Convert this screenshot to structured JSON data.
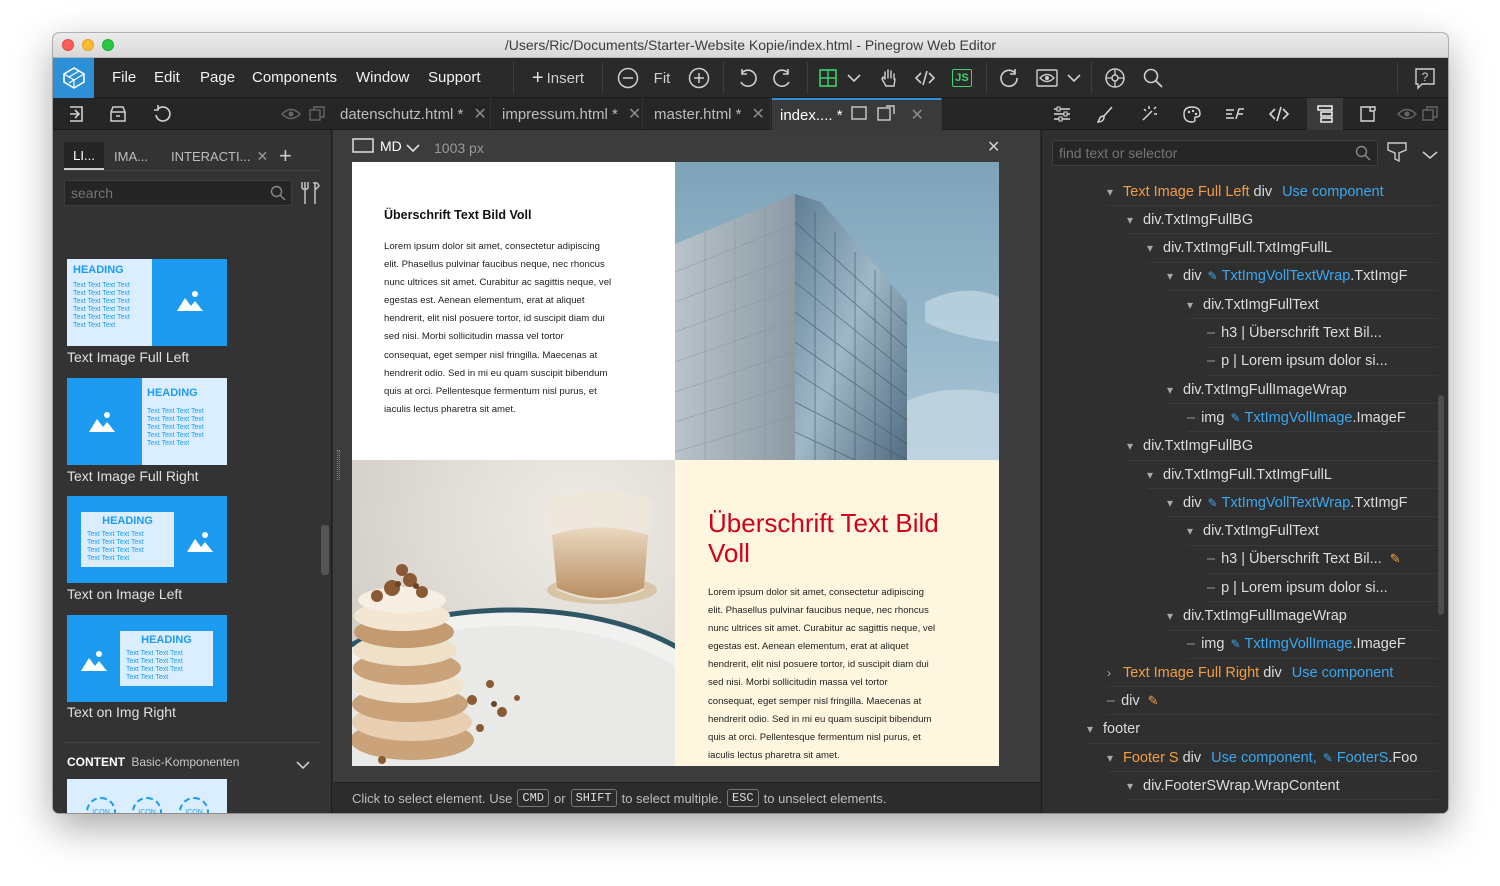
{
  "window": {
    "title": "/Users/Ric/Documents/Starter-Website Kopie/index.html - Pinegrow Web Editor"
  },
  "menu": {
    "items": [
      "File",
      "Edit",
      "Page",
      "Components",
      "Window",
      "Support"
    ],
    "insert_label": "Insert",
    "fit_label": "Fit",
    "js_label": "JS"
  },
  "tabs": [
    {
      "label": "datenschutz.html *",
      "active": false
    },
    {
      "label": "impressum.html *",
      "active": false
    },
    {
      "label": "master.html *",
      "active": false
    },
    {
      "label": "index.... *",
      "active": true
    }
  ],
  "library": {
    "tabs": [
      "LI...",
      "IMA...",
      "INTERACTI..."
    ],
    "search_placeholder": "search",
    "components": [
      {
        "label": "Text Image Full Left",
        "heading": "HEADING",
        "lines": [
          "Text Text Text Text",
          "Text Text Text Text",
          "Text Text Text Text",
          "Text Text Text Text",
          "Text Text Text Text",
          "Text Text Text"
        ]
      },
      {
        "label": "Text Image Full Right",
        "heading": "HEADING",
        "lines": [
          "Text Text Text Text",
          "Text Text Text Text",
          "Text Text Text Text",
          "Text Text Text Text",
          "Text Text Text"
        ]
      },
      {
        "label": "Text on Image Left",
        "heading": "HEADING",
        "lines": [
          "Text Text Text Text",
          "Text Text Text Text",
          "Text Text Text Text",
          "Text Text Text"
        ]
      },
      {
        "label": "Text on Img Right",
        "heading": "HEADING",
        "lines": [
          "Text Text Text Text",
          "Text Text Text Text",
          "Text Text Text Text",
          "Text Text Text"
        ]
      }
    ],
    "section_title": "CONTENT",
    "section_subtitle": "Basic-Komponenten",
    "icon_label": "ICON"
  },
  "canvas": {
    "device": "MD",
    "width_label": "1003 px",
    "block1_heading": "Überschrift Text Bild Voll",
    "block1_lines": [
      "Lorem ipsum dolor sit amet, consectetur adipiscing",
      "elit. Phasellus pulvinar faucibus neque, nec rhoncus",
      "nunc ultrices sit amet. Curabitur ac sagittis neque, vel",
      "egestas est. Aenean elementum, erat at aliquet",
      "hendrerit, elit nisl posuere tortor, id suscipit diam dui",
      "sed nisi. Morbi sollicitudin massa vel tortor",
      "consequat, eget semper nisl fringilla. Maecenas at",
      "hendrerit odio. Sed in mi eu quam suscipit bibendum",
      "quis at orci. Pellentesque fermentum nisl purus, et",
      "iaculis lectus pharetra sit amet."
    ],
    "block2_heading_line1": "Überschrift Text Bild",
    "block2_heading_line2": "Voll",
    "block2_lines": [
      "Lorem ipsum dolor sit amet, consectetur adipiscing",
      "elit. Phasellus pulvinar faucibus neque, nec rhoncus",
      "nunc ultrices sit amet. Curabitur ac sagittis neque, vel",
      "egestas est. Aenean elementum, erat at aliquet",
      "hendrerit, elit nisl posuere tortor, id suscipit diam dui",
      "sed nisi. Morbi sollicitudin massa vel tortor",
      "consequat, eget semper nisl fringilla. Maecenas at",
      "hendrerit odio. Sed in mi eu quam suscipit bibendum",
      "quis at orci. Pellentesque fermentum nisl purus, et",
      "iaculis lectus pharetra sit amet."
    ],
    "heading_color": "#d0021b",
    "cream_bg": "#fef6de"
  },
  "status": {
    "text1": "Click to select element. Use",
    "key1": "CMD",
    "text2": "or",
    "key2": "SHIFT",
    "text3": "to select multiple.",
    "key3": "ESC",
    "text4": "to unselect elements."
  },
  "tree": {
    "find_placeholder": "find text or selector",
    "rows": [
      {
        "arrow": "▾",
        "name": "Text Image Full Left",
        "tag": "div",
        "extra": "Use component"
      },
      {
        "arrow": "▾",
        "text": "div.TxtImgFullBG"
      },
      {
        "arrow": "▾",
        "text": "div.TxtImgFull.TxtImgFullL"
      },
      {
        "arrow": "▾",
        "tag": "div",
        "cls": "TxtImgVollTextWrap",
        "rest": ".TxtImgF"
      },
      {
        "arrow": "▾",
        "text": "div.TxtImgFullText"
      },
      {
        "dash": "–",
        "text": "h3 | Überschrift Text Bil..."
      },
      {
        "dash": "–",
        "text": "p | Lorem ipsum dolor si..."
      },
      {
        "arrow": "▾",
        "text": "div.TxtImgFullImageWrap"
      },
      {
        "dash": "–",
        "tag": "img",
        "cls": "TxtImgVollImage",
        "rest": ".ImageF"
      },
      {
        "arrow": "▾",
        "text": "div.TxtImgFullBG"
      },
      {
        "arrow": "▾",
        "text": "div.TxtImgFull.TxtImgFullL"
      },
      {
        "arrow": "▾",
        "tag": "div",
        "cls": "TxtImgVollTextWrap",
        "rest": ".TxtImgF"
      },
      {
        "arrow": "▾",
        "text": "div.TxtImgFullText"
      },
      {
        "dash": "–",
        "text": "h3 | Überschrift Text Bil..."
      },
      {
        "dash": "–",
        "text": "p | Lorem ipsum dolor si..."
      },
      {
        "arrow": "▾",
        "text": "div.TxtImgFullImageWrap"
      },
      {
        "dash": "–",
        "tag": "img",
        "cls": "TxtImgVollImage",
        "rest": ".ImageF"
      },
      {
        "arrow": "›",
        "name": "Text Image Full Right",
        "tag": "div",
        "extra": "Use component"
      },
      {
        "dash": "–",
        "tag": "div"
      },
      {
        "arrow": "▾",
        "text": "footer"
      },
      {
        "arrow": "▾",
        "name": "Footer S",
        "tag": "div",
        "extra": "Use component,",
        "cls": "FooterS",
        "rest": ".Foo"
      },
      {
        "arrow": "▾",
        "text": "div.FooterSWrap.WrapContent"
      }
    ]
  }
}
